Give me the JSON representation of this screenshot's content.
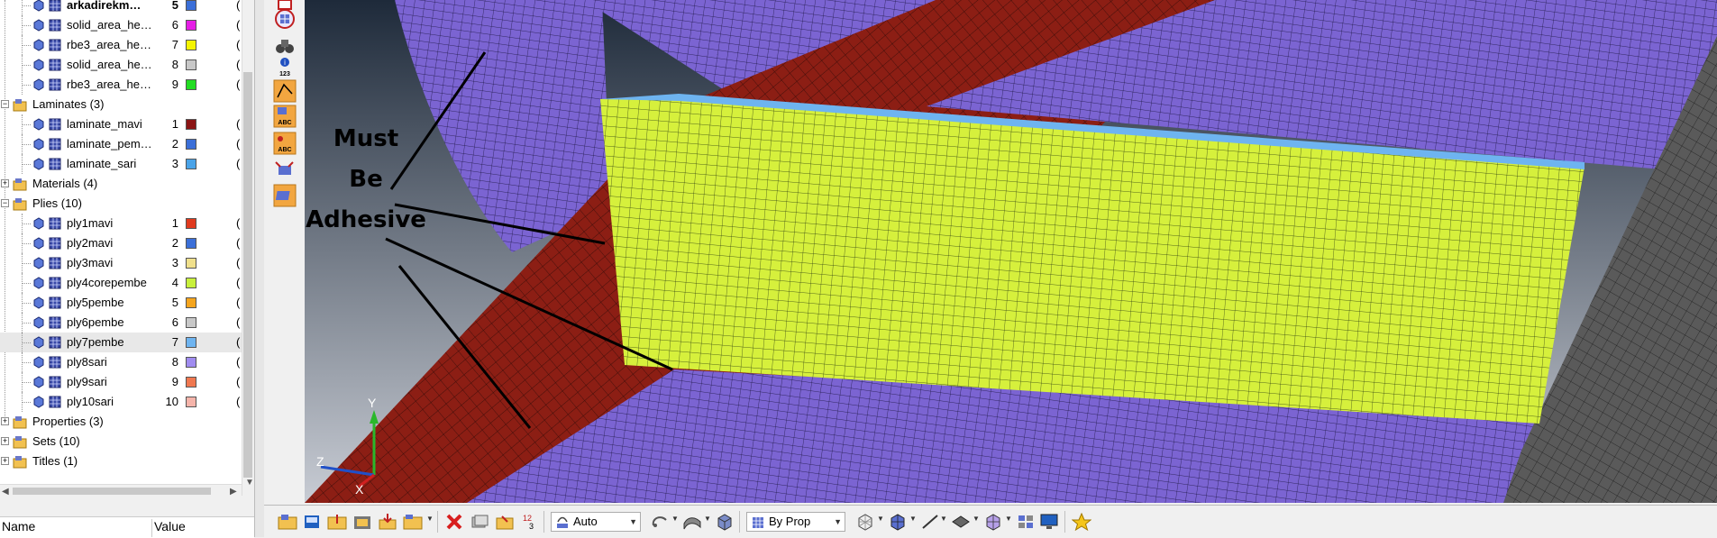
{
  "browser": {
    "rows": [
      {
        "kind": "item",
        "label": "arkadirekm…",
        "num": "5",
        "color": "#3b6fd8",
        "bold": true,
        "tail": "("
      },
      {
        "kind": "item",
        "label": "solid_area_he…",
        "num": "6",
        "color": "#e61ee6",
        "tail": "("
      },
      {
        "kind": "item",
        "label": "rbe3_area_he…",
        "num": "7",
        "color": "#f5f500",
        "tail": "("
      },
      {
        "kind": "item",
        "label": "solid_area_he…",
        "num": "8",
        "color": "#c8c8c8",
        "tail": "("
      },
      {
        "kind": "item",
        "label": "rbe3_area_he…",
        "num": "9",
        "color": "#22dd22",
        "tail": "("
      },
      {
        "kind": "group",
        "label": "Laminates (3)",
        "expanded": true,
        "icon": "laminates-folder-icon"
      },
      {
        "kind": "item",
        "label": "laminate_mavi",
        "num": "1",
        "color": "#8b1414",
        "tail": "("
      },
      {
        "kind": "item",
        "label": "laminate_pem…",
        "num": "2",
        "color": "#3b6fd8",
        "tail": "("
      },
      {
        "kind": "item",
        "label": "laminate_sari",
        "num": "3",
        "color": "#4aa3e8",
        "tail": "("
      },
      {
        "kind": "group",
        "label": "Materials (4)",
        "expanded": false,
        "icon": "materials-folder-icon"
      },
      {
        "kind": "group",
        "label": "Plies (10)",
        "expanded": true,
        "icon": "plies-folder-icon"
      },
      {
        "kind": "item",
        "label": "ply1mavi",
        "num": "1",
        "color": "#e03a1e",
        "tail": "("
      },
      {
        "kind": "item",
        "label": "ply2mavi",
        "num": "2",
        "color": "#3b6fd8",
        "tail": "("
      },
      {
        "kind": "item",
        "label": "ply3mavi",
        "num": "3",
        "color": "#f0e08c",
        "tail": "("
      },
      {
        "kind": "item",
        "label": "ply4corepembe",
        "num": "4",
        "color": "#c8f03c",
        "tail": "("
      },
      {
        "kind": "item",
        "label": "ply5pembe",
        "num": "5",
        "color": "#f5a51e",
        "tail": "("
      },
      {
        "kind": "item",
        "label": "ply6pembe",
        "num": "6",
        "color": "#c8c8c8",
        "tail": "("
      },
      {
        "kind": "item",
        "label": "ply7pembe",
        "num": "7",
        "color": "#6eb4f0",
        "tail": "(",
        "selected": true
      },
      {
        "kind": "item",
        "label": "ply8sari",
        "num": "8",
        "color": "#a08cf0",
        "tail": "("
      },
      {
        "kind": "item",
        "label": "ply9sari",
        "num": "9",
        "color": "#f07850",
        "tail": "("
      },
      {
        "kind": "item",
        "label": "ply10sari",
        "num": "10",
        "color": "#f5b4aa",
        "tail": "("
      },
      {
        "kind": "group",
        "label": "Properties (3)",
        "expanded": false,
        "icon": "properties-folder-icon"
      },
      {
        "kind": "group",
        "label": "Sets (10)",
        "expanded": false,
        "icon": "sets-folder-icon"
      },
      {
        "kind": "group",
        "label": "Titles (1)",
        "expanded": false,
        "icon": "titles-folder-icon"
      }
    ]
  },
  "properties_header": {
    "name": "Name",
    "value": "Value"
  },
  "annotation": {
    "line1": "Must",
    "line2": "Be",
    "line3": "Adhesive"
  },
  "toolbar": {
    "color_mode_combo": "Auto",
    "display_by_combo": "By Prop",
    "icons": [
      "open-model-icon",
      "save-model-icon",
      "import-icon",
      "export-icon",
      "solver-export-icon",
      "folder-icon",
      "delete-icon",
      "mask-icon",
      "unmask-icon",
      "counter-icon",
      "color-mode-icon",
      "rotate-icon",
      "shaded-icon",
      "box-icon",
      "wireframe-icon",
      "shaded-elements-icon",
      "line-icon",
      "feature-icon",
      "mesh-display-icon",
      "layers-icon",
      "display-icon",
      "favorite-star-icon"
    ]
  },
  "colors": {
    "mesh_purple": "#7b64d2",
    "mesh_red": "#8c1e14",
    "mesh_yellow": "#d6f03c",
    "mesh_gray": "#5a5a5a",
    "background_top": "#1e2a3a",
    "background_bottom": "#c8ccd4"
  }
}
